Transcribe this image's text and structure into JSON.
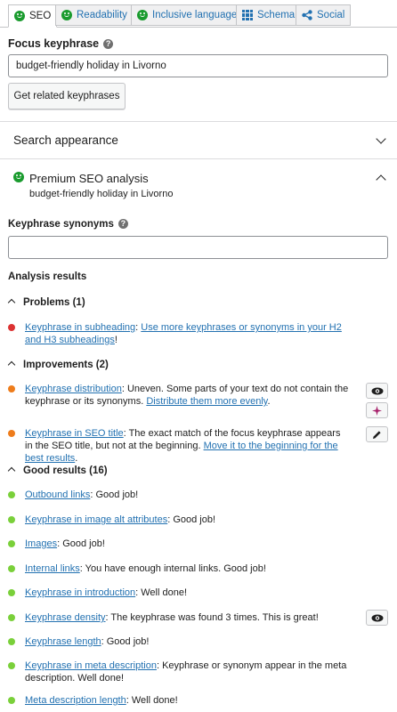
{
  "tabs": [
    {
      "label": "SEO",
      "icon": "smiley-good-icon",
      "active": true
    },
    {
      "label": "Readability",
      "icon": "smiley-good-icon"
    },
    {
      "label": "Inclusive language",
      "icon": "smiley-good-icon"
    },
    {
      "label": "Schema",
      "icon": "grid-icon"
    },
    {
      "label": "Social",
      "icon": "share-icon"
    }
  ],
  "focus": {
    "label": "Focus keyphrase",
    "value": "budget-friendly holiday in Livorno",
    "related_button": "Get related keyphrases"
  },
  "search_appearance": {
    "title": "Search appearance"
  },
  "premium": {
    "title": "Premium SEO analysis",
    "subtitle": "budget-friendly holiday in Livorno"
  },
  "synonyms": {
    "label": "Keyphrase synonyms",
    "value": ""
  },
  "analysis_title": "Analysis results",
  "problems": {
    "heading": "Problems (1)",
    "items": [
      {
        "link": "Keyphrase in subheading",
        "sep": ": ",
        "action": "Use more keyphrases or synonyms in your H2 and H3 subheadings",
        "end": "!"
      }
    ]
  },
  "improvements": {
    "heading": "Improvements (2)",
    "items": [
      {
        "link": "Keyphrase distribution",
        "text": ": Uneven. Some parts of your text do not contain the keyphrase or its synonyms. ",
        "action": "Distribute them more evenly",
        "end": "."
      },
      {
        "link": "Keyphrase in SEO title",
        "text": ": The exact match of the focus keyphrase appears in the SEO title, but not at the beginning. ",
        "action": "Move it to the beginning for the best results",
        "end": "."
      }
    ]
  },
  "good": {
    "heading": "Good results (16)",
    "items": [
      {
        "link": "Outbound links",
        "text": ": Good job!"
      },
      {
        "link": "Keyphrase in image alt attributes",
        "text": ": Good job!"
      },
      {
        "link": "Images",
        "text": ": Good job!"
      },
      {
        "link": "Internal links",
        "text": ": You have enough internal links. Good job!"
      },
      {
        "link": "Keyphrase in introduction",
        "text": ": Well done!"
      },
      {
        "link": "Keyphrase density",
        "text": ": The keyphrase was found 3 times. This is great!"
      },
      {
        "link": "Keyphrase length",
        "text": ": Good job!"
      },
      {
        "link": "Keyphrase in meta description",
        "text": ": Keyphrase or synonym appear in the meta description. Well done!"
      },
      {
        "link": "Meta description length",
        "text": ": Well done!"
      }
    ]
  },
  "colors": {
    "link": "#2271b1",
    "problem": "#dc3232",
    "improvement": "#ee7c1b",
    "good": "#7ad03a",
    "smiley": "#1a9b2e"
  }
}
